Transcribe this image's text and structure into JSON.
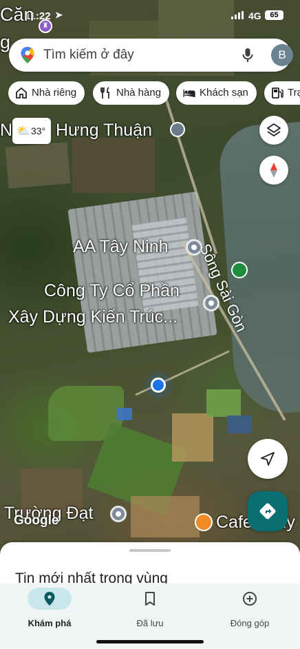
{
  "status_bar": {
    "time": "11:22",
    "network": "4G",
    "battery": "65"
  },
  "search": {
    "placeholder": "Tìm kiếm ở đây",
    "avatar_letter": "B"
  },
  "chips": [
    {
      "label": "Nhà riêng",
      "icon": "home-icon"
    },
    {
      "label": "Nhà hàng",
      "icon": "restaurant-icon"
    },
    {
      "label": "Khách sạn",
      "icon": "hotel-icon"
    },
    {
      "label": "Trạm xăng",
      "icon": "gas-station-icon"
    }
  ],
  "weather": {
    "temp": "33°"
  },
  "map_labels": {
    "top_left": "Căn",
    "top_left_2": "g",
    "place_1": "Hưng Thuận",
    "place_1_prefix": "N",
    "place_2": "AA Tây Ninh",
    "place_3_line1": "Công Ty Cổ Phần",
    "place_3_line2": "Xây Dựng Kiến Trúc...",
    "river": "Sông Sài Gòn",
    "place_4": "Trường Đạt",
    "place_5": "Cafe Thủy",
    "google": "Google"
  },
  "sheet": {
    "title": "Tin mới nhất trong vùng"
  },
  "nav": [
    {
      "label": "Khám phá",
      "icon": "explore-pin-icon",
      "active": true
    },
    {
      "label": "Đã lưu",
      "icon": "bookmark-icon",
      "active": false
    },
    {
      "label": "Đóng góp",
      "icon": "add-circle-icon",
      "active": false
    }
  ]
}
